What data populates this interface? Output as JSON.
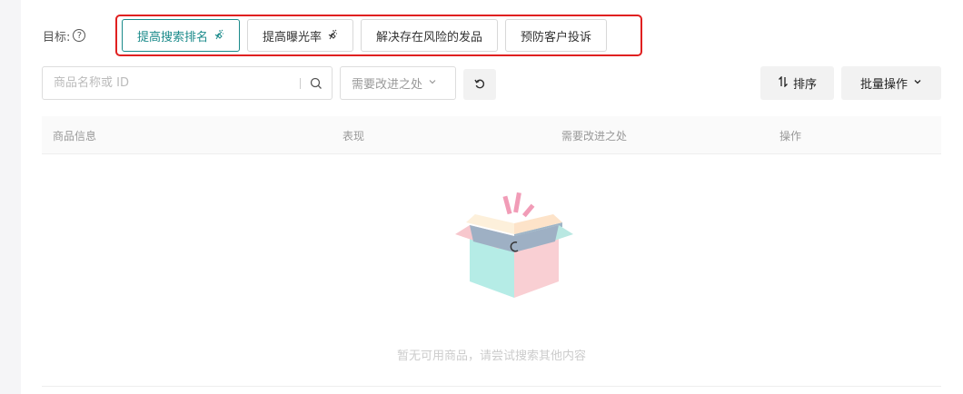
{
  "goal": {
    "label": "目标:",
    "help_icon": "?",
    "tabs": [
      {
        "label": "提高搜索排名",
        "active": true,
        "icon": "sparkle-icon"
      },
      {
        "label": "提高曝光率",
        "active": false,
        "icon": "sparkle-icon"
      },
      {
        "label": "解决存在风险的发品",
        "active": false
      },
      {
        "label": "预防客户投诉",
        "active": false
      }
    ]
  },
  "toolbar": {
    "search_placeholder": "商品名称或 ID",
    "filter_placeholder": "需要改进之处",
    "sort_label": "排序",
    "batch_label": "批量操作"
  },
  "table": {
    "columns": [
      "商品信息",
      "表现",
      "需要改进之处",
      "操作"
    ]
  },
  "empty": {
    "message": "暂无可用商品，请尝试搜索其他内容"
  },
  "colors": {
    "accent": "#1a8a8a",
    "highlight_border": "#e02020"
  }
}
